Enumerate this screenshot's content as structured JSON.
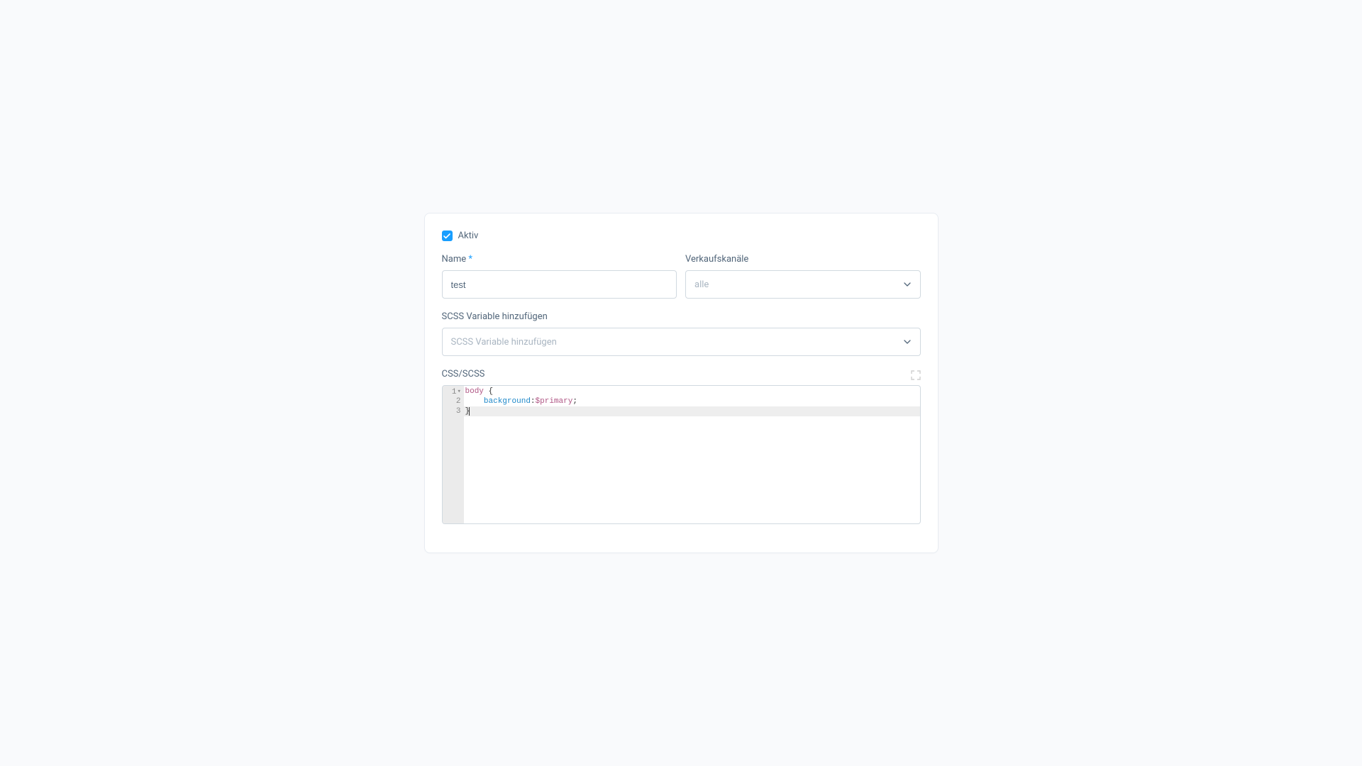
{
  "active": {
    "label": "Aktiv",
    "checked": true
  },
  "name": {
    "label": "Name",
    "required_marker": "*",
    "value": "test"
  },
  "sales_channels": {
    "label": "Verkaufskanäle",
    "value": "alle"
  },
  "scss_var": {
    "label": "SCSS Variable hinzufügen",
    "placeholder": "SCSS Variable hinzufügen"
  },
  "editor": {
    "label": "CSS/SCSS",
    "lines": {
      "l1_num": "1",
      "l2_num": "2",
      "l3_num": "3",
      "l1_sel": "body",
      "l1_brace": " {",
      "l2_prop": "background",
      "l2_colon": ":",
      "l2_val": "$primary",
      "l2_semi": ";",
      "l3_brace": "}"
    }
  }
}
